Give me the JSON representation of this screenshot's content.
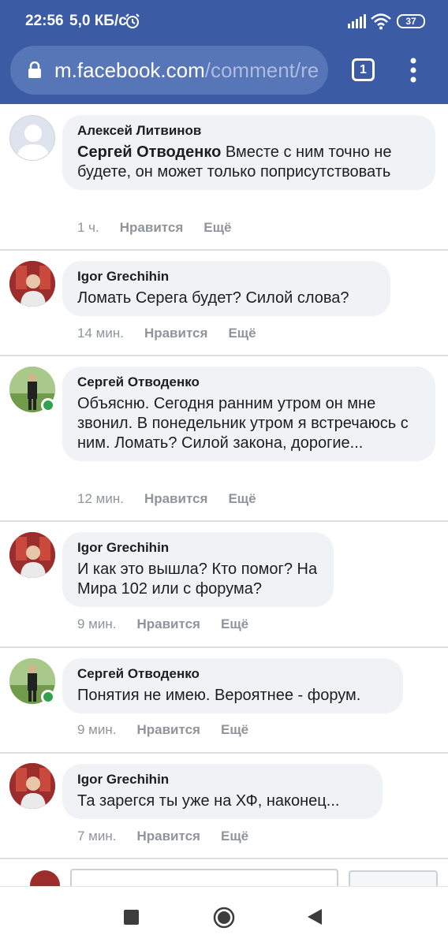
{
  "status_bar": {
    "time": "22:56",
    "speed": "5,0 КБ/с",
    "battery": "37"
  },
  "browser": {
    "url_host": "m.facebook.com",
    "url_path": "/comment/re",
    "tab_count": "1"
  },
  "comments": [
    {
      "author": "Алексей Литвинов",
      "mention": "Сергей Отводенко",
      "text": "Вместе с ним точно не будете, он может только поприсутствовать",
      "time": "1 ч.",
      "like": "Нравится",
      "more": "Ещё"
    },
    {
      "author": "Igor Grechihin",
      "text": "Ломать Серега будет? Силой слова?",
      "time": "14 мин.",
      "like": "Нравится",
      "more": "Ещё"
    },
    {
      "author": "Сергей Отводенко",
      "text": "Объясню. Сегодня ранним утром он мне звонил. В понедельник утром я встречаюсь с ним. Ломать? Силой закона, дорогие...",
      "time": "12 мин.",
      "like": "Нравится",
      "more": "Ещё",
      "online": true
    },
    {
      "author": "Igor Grechihin",
      "text": "И как это вышла? Кто помог? На Мира 102 или с форума?",
      "time": "9 мин.",
      "like": "Нравится",
      "more": "Ещё"
    },
    {
      "author": "Сергей Отводенко",
      "text": "Понятия не имею. Вероятнее - форум.",
      "time": "9 мин.",
      "like": "Нравится",
      "more": "Ещё",
      "online": true
    },
    {
      "author": "Igor Grechihin",
      "text": "Та зарегся ты уже на ХФ, наконец...",
      "time": "7 мин.",
      "like": "Нравится",
      "more": "Ещё"
    }
  ],
  "colors": {
    "header": "#3b5ba4",
    "bubble": "#f0f2f5",
    "online": "#31a24c",
    "meta": "#90949c"
  },
  "icons": {
    "alarm": "alarm-icon",
    "signal": "signal-icon",
    "wifi": "wifi-icon",
    "lock": "lock-icon",
    "menu": "more-vertical-icon",
    "nav_recents": "recents-square-icon",
    "nav_home": "home-circle-icon",
    "nav_back": "back-triangle-icon"
  }
}
